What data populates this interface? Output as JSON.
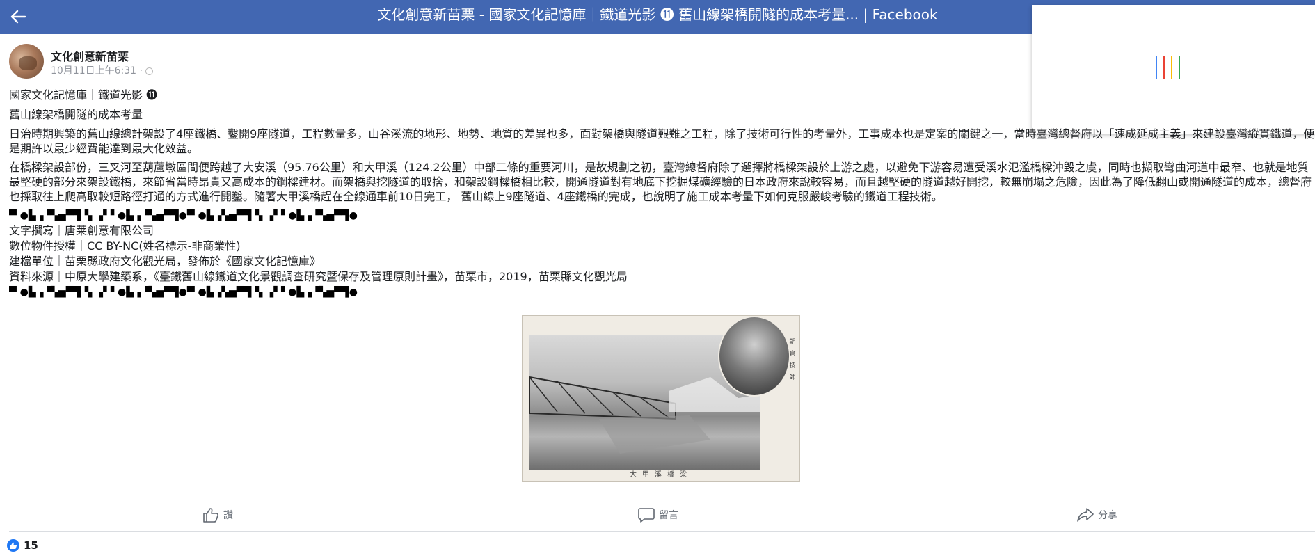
{
  "topbar": {
    "title": "文化創意新苗栗 - 國家文化記憶庫｜鐵道光影 ⓫ 舊山線架橋開隧的成本考量... | Facebook"
  },
  "post": {
    "page_name": "文化創意新苗栗",
    "timestamp": "10月11日上午6:31 ·",
    "lines": {
      "heading1": "國家文化記憶庫｜鐵道光影 ⓫",
      "heading2": "舊山線架橋開隧的成本考量",
      "p1": "日治時期興築的舊山線總計架設了4座鐵橋、鑿開9座隧道，工程數量多，山谷溪流的地形、地勢、地質的差異也多，面對架橋與隧道艱難之工程，除了技術可行性的考量外，工事成本也是定案的關鍵之一，當時臺灣總督府以「速成延成主義」來建設臺灣縱貫鐵道，便是期許以最少經費能達到最大化效益。",
      "p2": "在橋樑架設部份，三叉河至葫蘆墩區間便跨越了大安溪（95.76公里）和大甲溪（124.2公里）中部二條的重要河川，是故規劃之初，臺灣總督府除了選擇將橋樑架設於上游之處，以避免下游容易遭受溪水氾濫橋樑沖毀之虞，同時也擷取彎曲河道中最窄、也就是地質最堅硬的部分來架設鐵橋，來節省當時昂貴又高成本的鋼樑建材。而架橋與挖隧道的取捨，和架設鋼樑橋相比較，開通隧道對有地底下挖掘煤礦經驗的日本政府來說較容易，而且越堅硬的隧道越好開挖，較無崩塌之危險，因此為了降低翻山或開通隧道的成本，總督府也採取往上爬高取較短路徑打通的方式進行開鑿。隨著大甲溪橋趕在全線通車前10日完工， 舊山線上9座隧道、4座鐵橋的完成，也說明了施工成本考量下如何克服嚴峻考驗的鐵道工程技術。",
      "deco1": "▀ ●▙▗▝▚▅▀▜▝▖ ▞▝ ●▙▗▝▚▅▀▜●▀ ●▙▗▚▅▀▜▝▖ ▞▝ ●▙▗▝▚▅▀▜●",
      "credit1": "文字撰寫｜唐莱創意有限公司",
      "credit2": "數位物件授權｜CC BY-NC(姓名標示-非商業性)",
      "credit3": "建檔單位｜苗栗縣政府文化觀光局，發佈於《國家文化記憶庫》",
      "credit4": "資料來源｜中原大學建築系，《臺鐵舊山線鐵道文化景觀調查研究暨保存及管理原則計畫》，苗栗市，2019，苗栗縣文化觀光局",
      "deco2": "▀ ●▙▗▝▚▅▀▜▝▖ ▞▝ ●▙▗▝▚▅▀▜●▀ ●▙▗▚▅▀▜▝▖ ▞▝ ●▙▗▝▚▅▀▜●"
    },
    "photo": {
      "caption": "大甲溪橋梁",
      "side_caption": "朝倉技師"
    }
  },
  "actions": {
    "like": "讚",
    "comment": "留言",
    "share": "分享"
  },
  "reactions": {
    "count": "15"
  },
  "colors": {
    "topbar": "#4267b2",
    "like_badge": "#2078f4",
    "loader": [
      "#4285f4",
      "#ea4335",
      "#fbbc05",
      "#34a853"
    ]
  }
}
